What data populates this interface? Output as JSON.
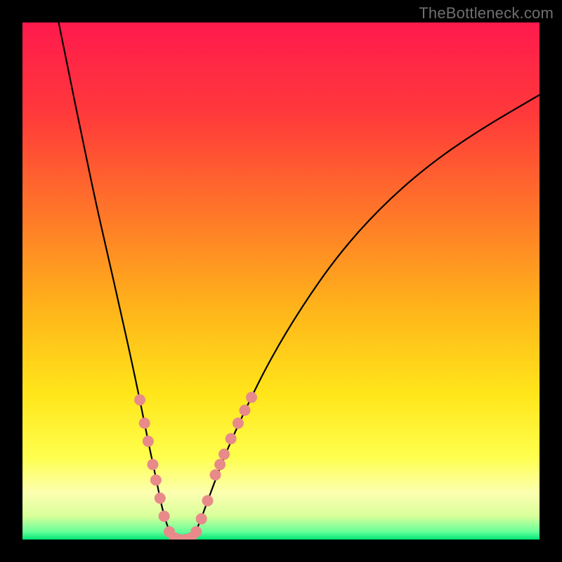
{
  "watermark": "TheBottleneck.com",
  "chart_data": {
    "type": "line",
    "title": "",
    "xlabel": "",
    "ylabel": "",
    "xlim": [
      0,
      100
    ],
    "ylim": [
      0,
      100
    ],
    "grid": false,
    "legend": false,
    "background_gradient_stops": [
      {
        "offset": 0.0,
        "color": "#ff1a4d"
      },
      {
        "offset": 0.18,
        "color": "#ff3a3a"
      },
      {
        "offset": 0.38,
        "color": "#ff7a28"
      },
      {
        "offset": 0.55,
        "color": "#ffb31a"
      },
      {
        "offset": 0.72,
        "color": "#ffe61a"
      },
      {
        "offset": 0.84,
        "color": "#ffff4d"
      },
      {
        "offset": 0.91,
        "color": "#fcffb0"
      },
      {
        "offset": 0.955,
        "color": "#d8ff9a"
      },
      {
        "offset": 0.985,
        "color": "#66ff99"
      },
      {
        "offset": 1.0,
        "color": "#00e676"
      }
    ],
    "series": [
      {
        "name": "left-curve",
        "stroke": "#000000",
        "stroke_width": 2.2,
        "points": [
          {
            "x": 7.0,
            "y": 100.0
          },
          {
            "x": 9.0,
            "y": 90.0
          },
          {
            "x": 11.5,
            "y": 78.0
          },
          {
            "x": 14.0,
            "y": 66.0
          },
          {
            "x": 16.5,
            "y": 55.0
          },
          {
            "x": 19.0,
            "y": 44.0
          },
          {
            "x": 21.0,
            "y": 35.0
          },
          {
            "x": 22.7,
            "y": 27.0
          },
          {
            "x": 24.3,
            "y": 19.0
          },
          {
            "x": 25.8,
            "y": 12.0
          },
          {
            "x": 27.0,
            "y": 6.0
          },
          {
            "x": 28.2,
            "y": 2.0
          },
          {
            "x": 29.2,
            "y": 0.4
          },
          {
            "x": 30.0,
            "y": 0.0
          }
        ]
      },
      {
        "name": "right-curve",
        "stroke": "#000000",
        "stroke_width": 2.2,
        "points": [
          {
            "x": 32.0,
            "y": 0.0
          },
          {
            "x": 32.8,
            "y": 0.4
          },
          {
            "x": 34.0,
            "y": 2.5
          },
          {
            "x": 36.0,
            "y": 8.0
          },
          {
            "x": 39.0,
            "y": 16.0
          },
          {
            "x": 43.0,
            "y": 25.0
          },
          {
            "x": 48.0,
            "y": 35.0
          },
          {
            "x": 54.0,
            "y": 45.0
          },
          {
            "x": 61.0,
            "y": 55.0
          },
          {
            "x": 69.0,
            "y": 64.0
          },
          {
            "x": 78.0,
            "y": 72.0
          },
          {
            "x": 88.0,
            "y": 79.0
          },
          {
            "x": 100.0,
            "y": 86.0
          }
        ]
      },
      {
        "name": "floor",
        "stroke": "#000000",
        "stroke_width": 2.2,
        "points": [
          {
            "x": 29.2,
            "y": 0.0
          },
          {
            "x": 32.8,
            "y": 0.0
          }
        ]
      }
    ],
    "markers": {
      "name": "highlight-dots",
      "fill": "#e88a8a",
      "radius": 8,
      "points": [
        {
          "x": 22.7,
          "y": 27.0
        },
        {
          "x": 23.6,
          "y": 22.5
        },
        {
          "x": 24.3,
          "y": 19.0
        },
        {
          "x": 25.2,
          "y": 14.5
        },
        {
          "x": 25.8,
          "y": 11.5
        },
        {
          "x": 26.6,
          "y": 8.0
        },
        {
          "x": 27.4,
          "y": 4.5
        },
        {
          "x": 28.4,
          "y": 1.5
        },
        {
          "x": 29.4,
          "y": 0.3
        },
        {
          "x": 30.4,
          "y": 0.0
        },
        {
          "x": 31.6,
          "y": 0.0
        },
        {
          "x": 32.6,
          "y": 0.3
        },
        {
          "x": 33.6,
          "y": 1.5
        },
        {
          "x": 34.6,
          "y": 4.0
        },
        {
          "x": 35.8,
          "y": 7.5
        },
        {
          "x": 37.3,
          "y": 12.5
        },
        {
          "x": 38.2,
          "y": 14.5
        },
        {
          "x": 39.0,
          "y": 16.5
        },
        {
          "x": 40.3,
          "y": 19.5
        },
        {
          "x": 41.7,
          "y": 22.5
        },
        {
          "x": 43.0,
          "y": 25.0
        },
        {
          "x": 44.3,
          "y": 27.5
        }
      ]
    }
  }
}
